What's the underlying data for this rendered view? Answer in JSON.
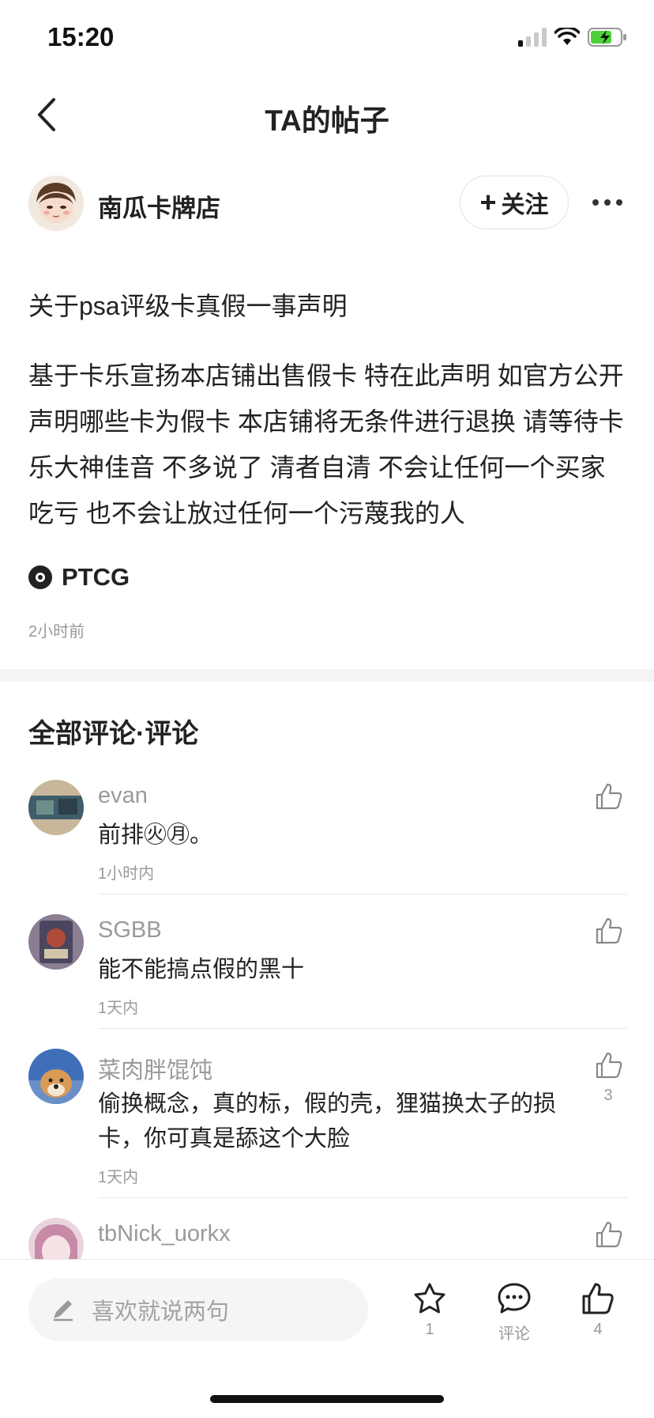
{
  "status_bar": {
    "time": "15:20"
  },
  "nav": {
    "title": "TA的帖子"
  },
  "author": {
    "name": "南瓜卡牌店",
    "follow_label": "关注"
  },
  "post": {
    "title": "关于psa评级卡真假一事声明",
    "body": "基于卡乐宣扬本店铺出售假卡 特在此声明 如官方公开声明哪些卡为假卡 本店铺将无条件进行退换 请等待卡乐大神佳音 不多说了 清者自清 不会让任何一个买家吃亏 也不会让放过任何一个污蔑我的人",
    "tag": "PTCG",
    "time": "2小时前"
  },
  "comments_section": {
    "title": "全部评论·评论",
    "comments": [
      {
        "name": "evan",
        "text": "前排㊋㊊。",
        "time": "1小时内",
        "likes": ""
      },
      {
        "name": "SGBB",
        "text": "能不能搞点假的黑十",
        "time": "1天内",
        "likes": ""
      },
      {
        "name": "菜肉胖馄饨",
        "text": "偷换概念，真的标，假的壳，狸猫换太子的损卡，你可真是舔这个大脸",
        "time": "1天内",
        "likes": "3"
      },
      {
        "name": "tbNick_uorkx",
        "text": "",
        "time": "",
        "likes": ""
      }
    ]
  },
  "bottom_bar": {
    "input_placeholder": "喜欢就说两句",
    "star_count": "1",
    "comment_label": "评论",
    "like_count": "4"
  },
  "colors": {
    "text": "#222222",
    "muted": "#9a9a9a",
    "divider": "#f4f4f4"
  }
}
